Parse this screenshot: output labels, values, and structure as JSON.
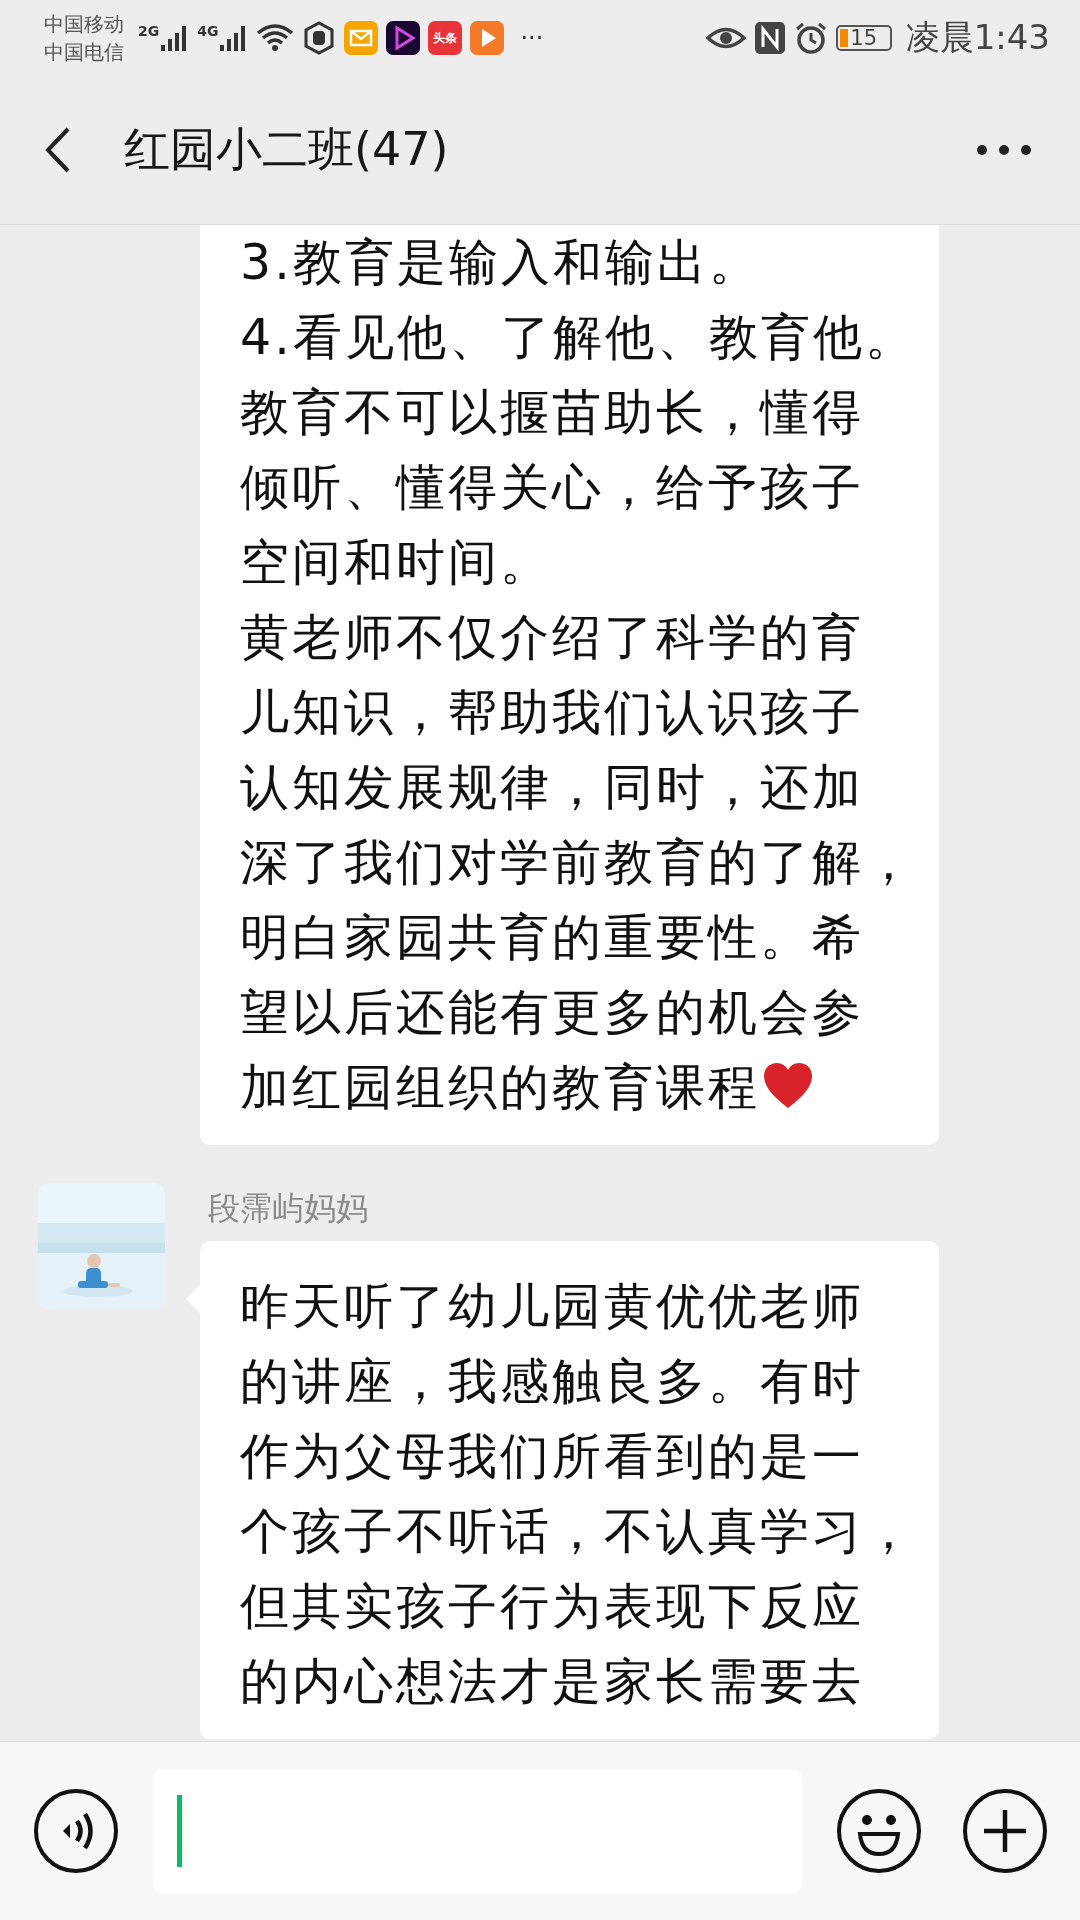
{
  "status_bar": {
    "carriers": [
      "中国移动",
      "中国电信"
    ],
    "signals": [
      "2G",
      "4G"
    ],
    "app_icon_label": "头条",
    "more": "···",
    "battery": "15",
    "time": "凌晨1:43"
  },
  "header": {
    "title": "红园小二班(47)"
  },
  "messages": [
    {
      "lines": [
        "3.教育是输入和输出。",
        "4.看见他、了解他、教育他。",
        "教育不可以揠苗助长，懂得",
        "倾听、懂得关心，给予孩子",
        "空间和时间。",
        "黄老师不仅介绍了科学的育",
        "儿知识，帮助我们认识孩子",
        "认知发展规律，同时，还加",
        "深了我们对学前教育的了解，",
        "明白家园共育的重要性。希",
        "望以后还能有更多的机会参",
        "加红园组织的教育课程"
      ],
      "emoji": {
        "kind": "heart"
      }
    },
    {
      "sender": "段霈屿妈妈",
      "lines": [
        "昨天听了幼儿园黄优优老师",
        "的讲座，我感触良多。有时",
        "作为父母我们所看到的是一",
        "个孩子不听话，不认真学习，",
        "但其实孩子行为表现下反应",
        "的内心想法才是家长需要去"
      ]
    }
  ]
}
